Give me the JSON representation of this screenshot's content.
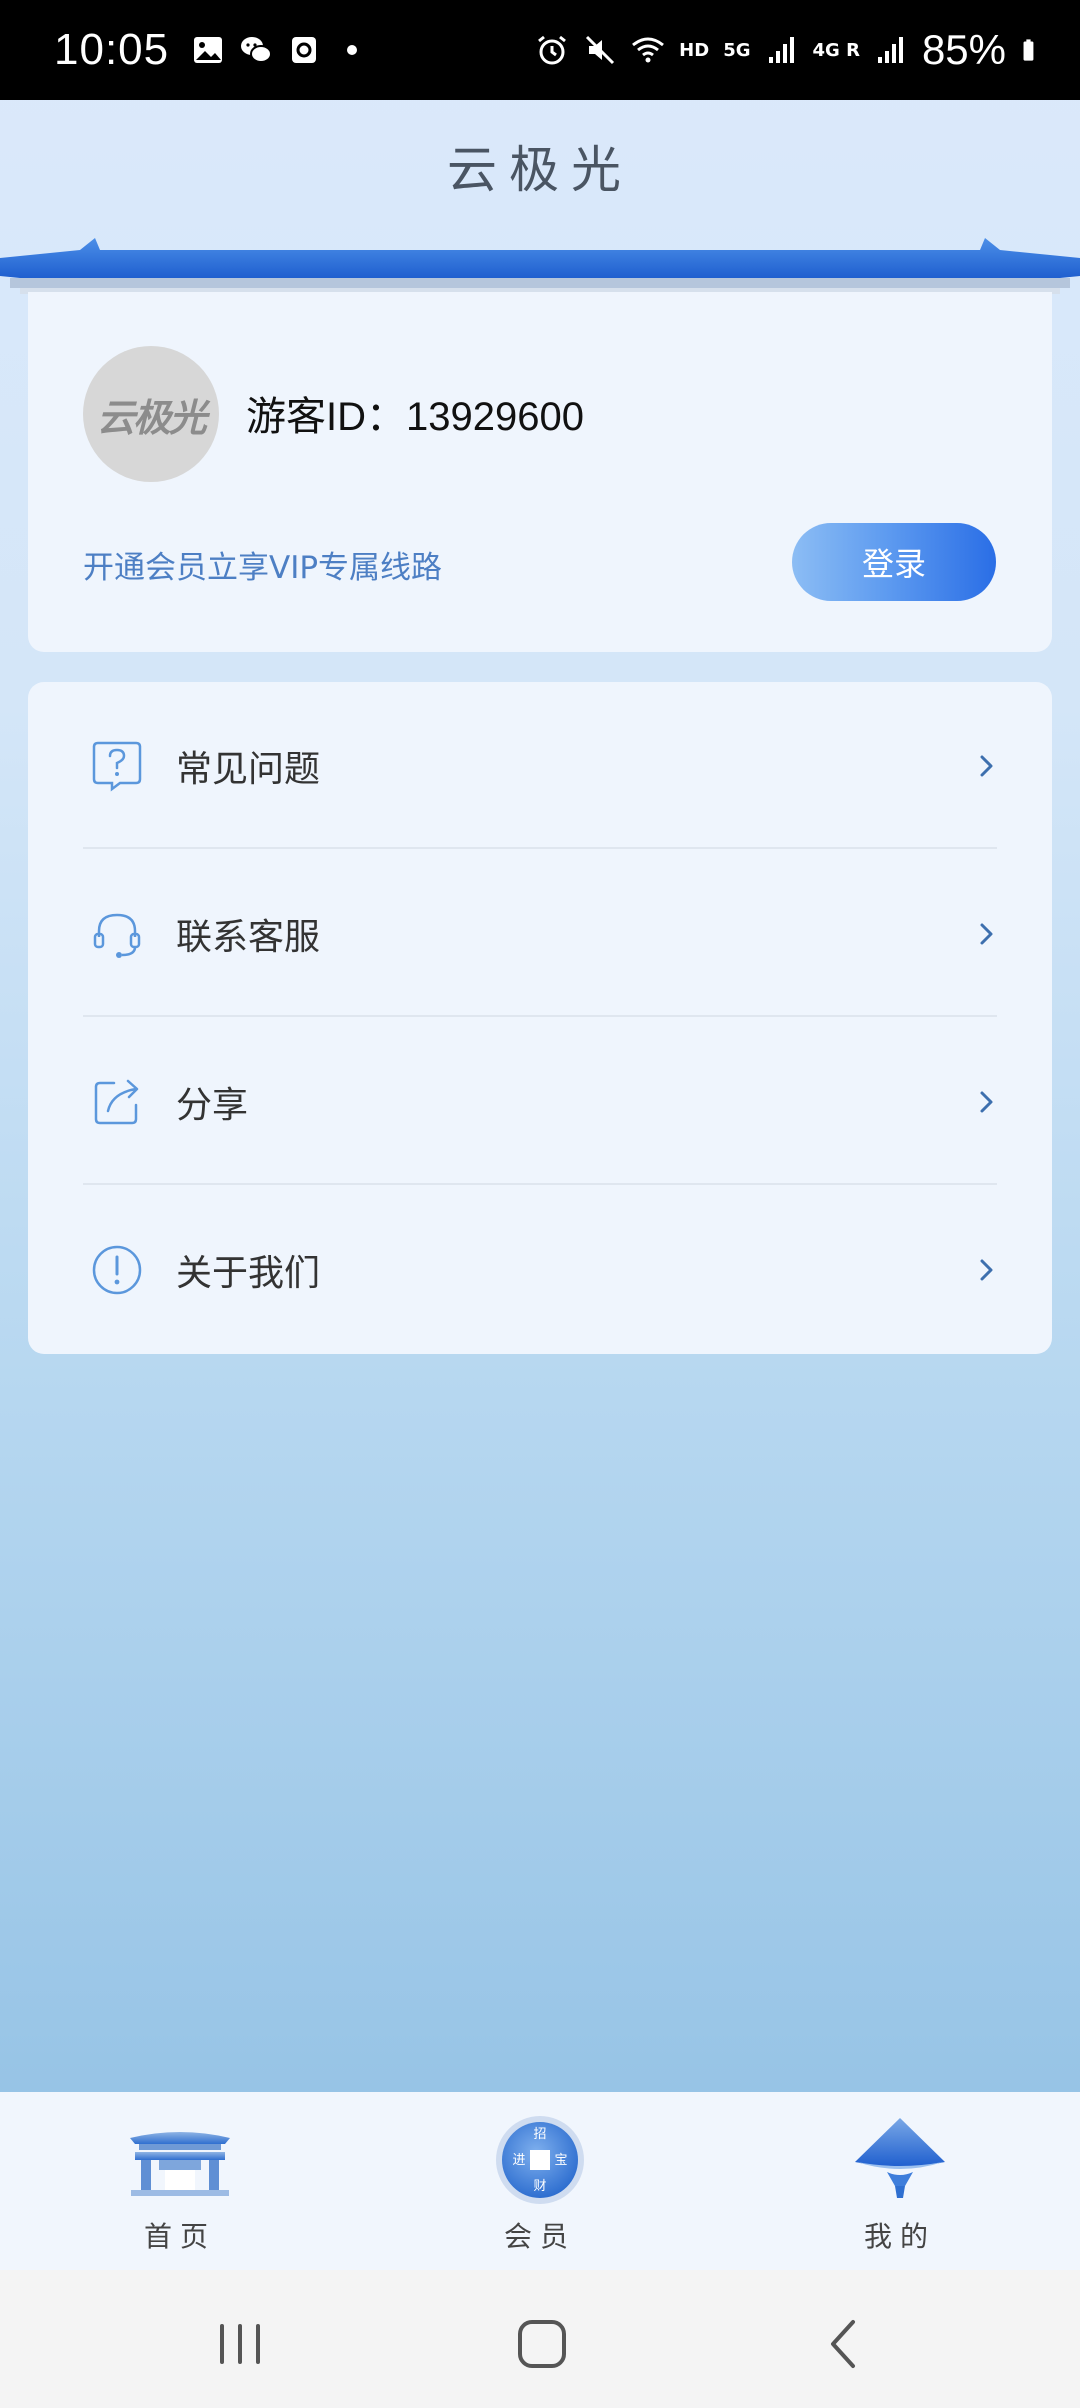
{
  "status_bar": {
    "time": "10:05",
    "network_hd": "HD",
    "network_5g": "5G",
    "network_4g": "4G R",
    "battery": "85%"
  },
  "header": {
    "title": "云极光"
  },
  "profile": {
    "avatar_text": "云极光",
    "guest_id": "游客ID：13929600",
    "vip_text": "开通会员立享VIP专属线路",
    "login_label": "登录"
  },
  "menu": {
    "items": [
      {
        "label": "常见问题",
        "icon": "question-icon"
      },
      {
        "label": "联系客服",
        "icon": "headset-icon"
      },
      {
        "label": "分享",
        "icon": "share-icon"
      },
      {
        "label": "关于我们",
        "icon": "info-icon"
      }
    ]
  },
  "bottom_nav": {
    "tabs": [
      {
        "label": "首页",
        "icon": "home-gate-icon"
      },
      {
        "label": "会员",
        "icon": "coin-icon",
        "coin_chars": [
          "招",
          "宝",
          "财",
          "进"
        ]
      },
      {
        "label": "我的",
        "icon": "hat-icon",
        "active": true
      }
    ]
  },
  "colors": {
    "accent": "#2a6ee6",
    "vip_text": "#4d7fc4",
    "icon_blue": "#5b97dc"
  }
}
